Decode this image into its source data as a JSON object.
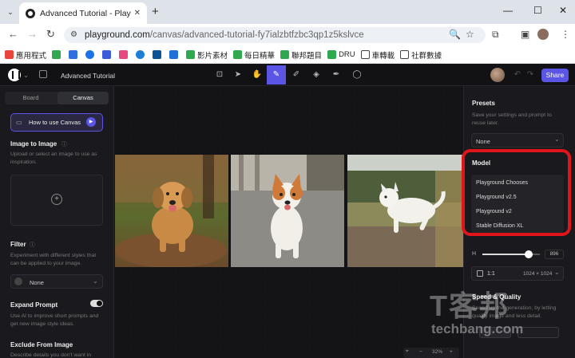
{
  "browser": {
    "tab_title": "Advanced Tutorial - Playgrou",
    "url_host": "playground.com",
    "url_path": "/canvas/advanced-tutorial-fy7ialzbtfzbc3qp1z5kslvce",
    "bookmarks": [
      "應用程式",
      "影片素材",
      "每日精華",
      "聯邦題目",
      "DRU",
      "車轉載",
      "社群數據"
    ]
  },
  "app": {
    "project_title": "Advanced Tutorial",
    "share_label": "Share",
    "brand_color": "#5b55e6"
  },
  "left_panel": {
    "tabs": [
      "Board",
      "Canvas"
    ],
    "active_tab": "Canvas",
    "how_to": "How to use Canvas",
    "image_to_image": {
      "title": "Image to Image",
      "desc_1": "Upload or select an image to use as",
      "desc_2": "inspiration."
    },
    "filter": {
      "title": "Filter",
      "desc_1": "Experiment with different styles that",
      "desc_2": "can be applied to your image.",
      "value": "None"
    },
    "expand_prompt": {
      "title": "Expand Prompt",
      "desc_1": "Use AI to improve short prompts and",
      "desc_2": "get new image style ideas."
    },
    "exclude": {
      "title": "Exclude From Image",
      "desc_1": "Describe details you don't want in"
    }
  },
  "right_panel": {
    "presets": {
      "title": "Presets",
      "desc_1": "Save your settings and prompt to",
      "desc_2": "reuse later.",
      "value": "None"
    },
    "model": {
      "title": "Model",
      "options": [
        "Playground Chooses",
        "Playground v2.5",
        "Playground v2",
        "Stable Diffusion XL"
      ]
    },
    "h_label": "H",
    "h_value": "896",
    "size_ratio": "1:1",
    "size_dims": "1024 × 1024",
    "speed": {
      "title": "Speed & Quality",
      "desc_1": "Speed up the generation, by letting",
      "desc_2": "quality image and less detail."
    }
  },
  "canvas": {
    "zoom": "32%",
    "images": [
      "golden-retriever-running",
      "corgi-mix-running",
      "white-dog-running"
    ]
  },
  "watermark": {
    "text": "techbang.com",
    "mark": "T客邦"
  }
}
